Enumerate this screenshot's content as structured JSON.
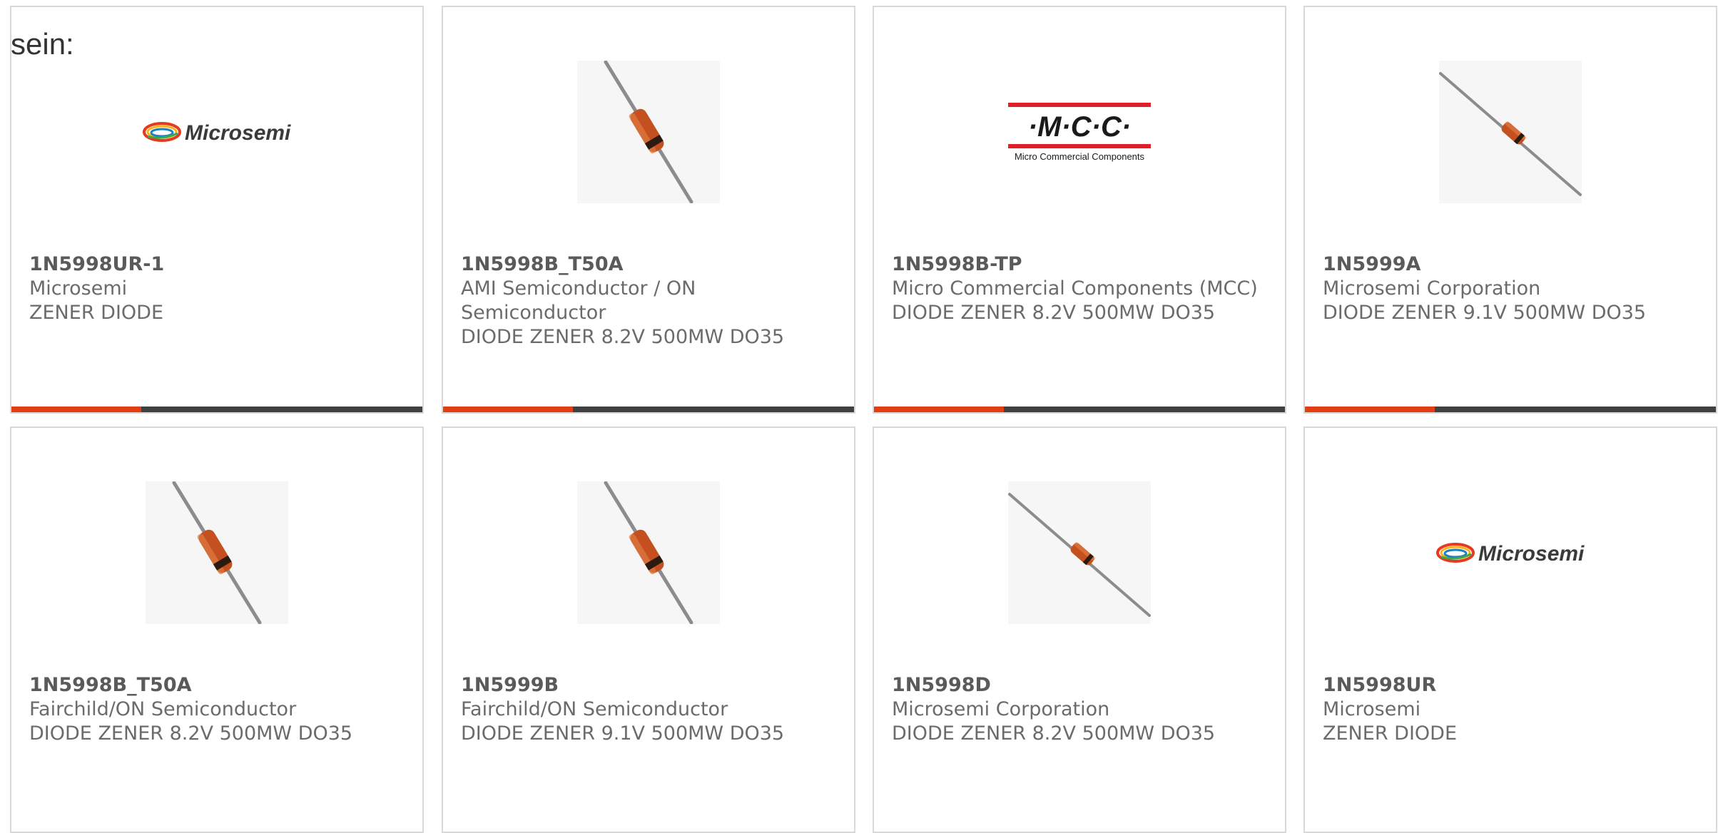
{
  "intro_text": "sein:",
  "colors": {
    "accent": "#e43d12",
    "bar": "#3f4040",
    "border": "#d8d8d8",
    "text": "#6b6b6b"
  },
  "cards": [
    {
      "part": "1N5998UR-1",
      "manufacturer": "Microsemi",
      "description": "ZENER DIODE",
      "image": "microsemi-logo",
      "logo_text": "Microsemi"
    },
    {
      "part": "1N5998B_T50A",
      "manufacturer": "AMI Semiconductor / ON Semiconductor",
      "description": "DIODE ZENER 8.2V 500MW DO35",
      "image": "diode-steep-photo"
    },
    {
      "part": "1N5998B-TP",
      "manufacturer": "Micro Commercial Components (MCC)",
      "description": "DIODE ZENER 8.2V 500MW DO35",
      "image": "mcc-logo",
      "logo_text": "·M·C·C·",
      "logo_subtext": "Micro Commercial Components"
    },
    {
      "part": "1N5999A",
      "manufacturer": "Microsemi Corporation",
      "description": "DIODE ZENER 9.1V 500MW DO35",
      "image": "diode-diagonal-photo"
    },
    {
      "part": "1N5998B_T50A",
      "manufacturer": "Fairchild/ON Semiconductor",
      "description": "DIODE ZENER 8.2V 500MW DO35",
      "image": "diode-steep-photo"
    },
    {
      "part": "1N5999B",
      "manufacturer": "Fairchild/ON Semiconductor",
      "description": "DIODE ZENER 9.1V 500MW DO35",
      "image": "diode-steep-photo"
    },
    {
      "part": "1N5998D",
      "manufacturer": "Microsemi Corporation",
      "description": "DIODE ZENER 8.2V 500MW DO35",
      "image": "diode-diagonal-photo"
    },
    {
      "part": "1N5998UR",
      "manufacturer": "Microsemi",
      "description": "ZENER DIODE",
      "image": "microsemi-logo",
      "logo_text": "Microsemi"
    }
  ]
}
